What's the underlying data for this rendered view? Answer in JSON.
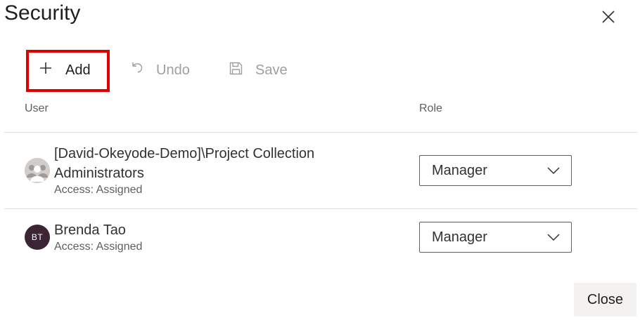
{
  "dialog": {
    "title": "Security"
  },
  "toolbar": {
    "add_label": "Add",
    "undo_label": "Undo",
    "save_label": "Save"
  },
  "table": {
    "columns": [
      "User",
      "Role"
    ],
    "rows": [
      {
        "name": "[David-Okeyode-Demo]\\Project Collection Administrators",
        "access": "Access: Assigned",
        "avatar": "group-avatar",
        "role": "Manager"
      },
      {
        "name": "Brenda Tao",
        "access": "Access: Assigned",
        "avatar_initials": "BT",
        "role": "Manager"
      }
    ]
  },
  "footer": {
    "close_label": "Close"
  },
  "colors": {
    "highlight": "#e00000",
    "avatar_bt": "#3b2434"
  }
}
